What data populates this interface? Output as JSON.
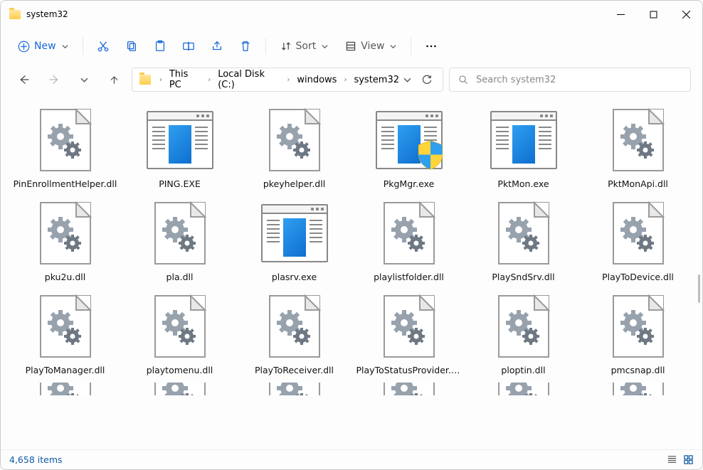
{
  "window": {
    "title": "system32"
  },
  "toolbar": {
    "new_label": "New",
    "sort_label": "Sort",
    "view_label": "View"
  },
  "breadcrumbs": [
    "This PC",
    "Local Disk (C:)",
    "windows",
    "system32"
  ],
  "search": {
    "placeholder": "Search system32"
  },
  "files": [
    {
      "name": "PinEnrollmentHelper.dll",
      "icon": "dll"
    },
    {
      "name": "PING.EXE",
      "icon": "exe"
    },
    {
      "name": "pkeyhelper.dll",
      "icon": "dll"
    },
    {
      "name": "PkgMgr.exe",
      "icon": "exe-shield"
    },
    {
      "name": "PktMon.exe",
      "icon": "exe"
    },
    {
      "name": "PktMonApi.dll",
      "icon": "dll"
    },
    {
      "name": "pku2u.dll",
      "icon": "dll"
    },
    {
      "name": "pla.dll",
      "icon": "dll"
    },
    {
      "name": "plasrv.exe",
      "icon": "exe"
    },
    {
      "name": "playlistfolder.dll",
      "icon": "dll"
    },
    {
      "name": "PlaySndSrv.dll",
      "icon": "dll"
    },
    {
      "name": "PlayToDevice.dll",
      "icon": "dll"
    },
    {
      "name": "PlayToManager.dll",
      "icon": "dll"
    },
    {
      "name": "playtomenu.dll",
      "icon": "dll"
    },
    {
      "name": "PlayToReceiver.dll",
      "icon": "dll"
    },
    {
      "name": "PlayToStatusProvider.dll",
      "icon": "dll"
    },
    {
      "name": "ploptin.dll",
      "icon": "dll"
    },
    {
      "name": "pmcsnap.dll",
      "icon": "dll"
    }
  ],
  "status": {
    "item_count": "4,658 items"
  }
}
